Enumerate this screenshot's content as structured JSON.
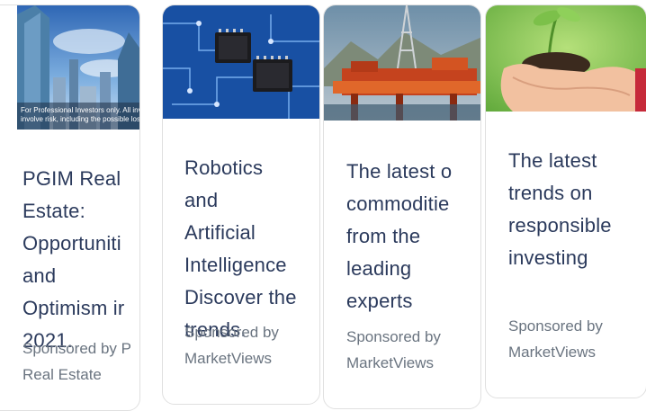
{
  "cards": [
    {
      "title_lines": [
        "PGIM Real",
        "Estate:",
        "Opportuniti",
        "and",
        "Optimism ir",
        "2021."
      ],
      "sponsor_lines": [
        "Sponsored by P",
        "Real Estate"
      ],
      "image": "city-skyscrapers-image",
      "disclaimer_lines": [
        "For Professional Investors only. All investme",
        "involve risk, including the possible loss of c"
      ]
    },
    {
      "title_lines": [
        "Robotics",
        "and",
        "Artificial",
        "Intelligence",
        "Discover the",
        "trends."
      ],
      "sponsor_lines": [
        "Sponsored by",
        "MarketViews"
      ],
      "image": "circuit-board-image"
    },
    {
      "title_lines": [
        "The latest o",
        "commoditie",
        "from the",
        "leading",
        "experts"
      ],
      "sponsor_lines": [
        "Sponsored by",
        "MarketViews"
      ],
      "image": "oil-rig-image"
    },
    {
      "title_lines": [
        "The latest",
        "trends on",
        "responsible",
        "investing"
      ],
      "sponsor_lines": [
        "Sponsored by",
        "MarketViews"
      ],
      "image": "seedling-hands-image"
    }
  ],
  "colors": {
    "title": "#2b3a5c",
    "sponsor": "#6a7480",
    "card_border": "#e0e0e0"
  }
}
